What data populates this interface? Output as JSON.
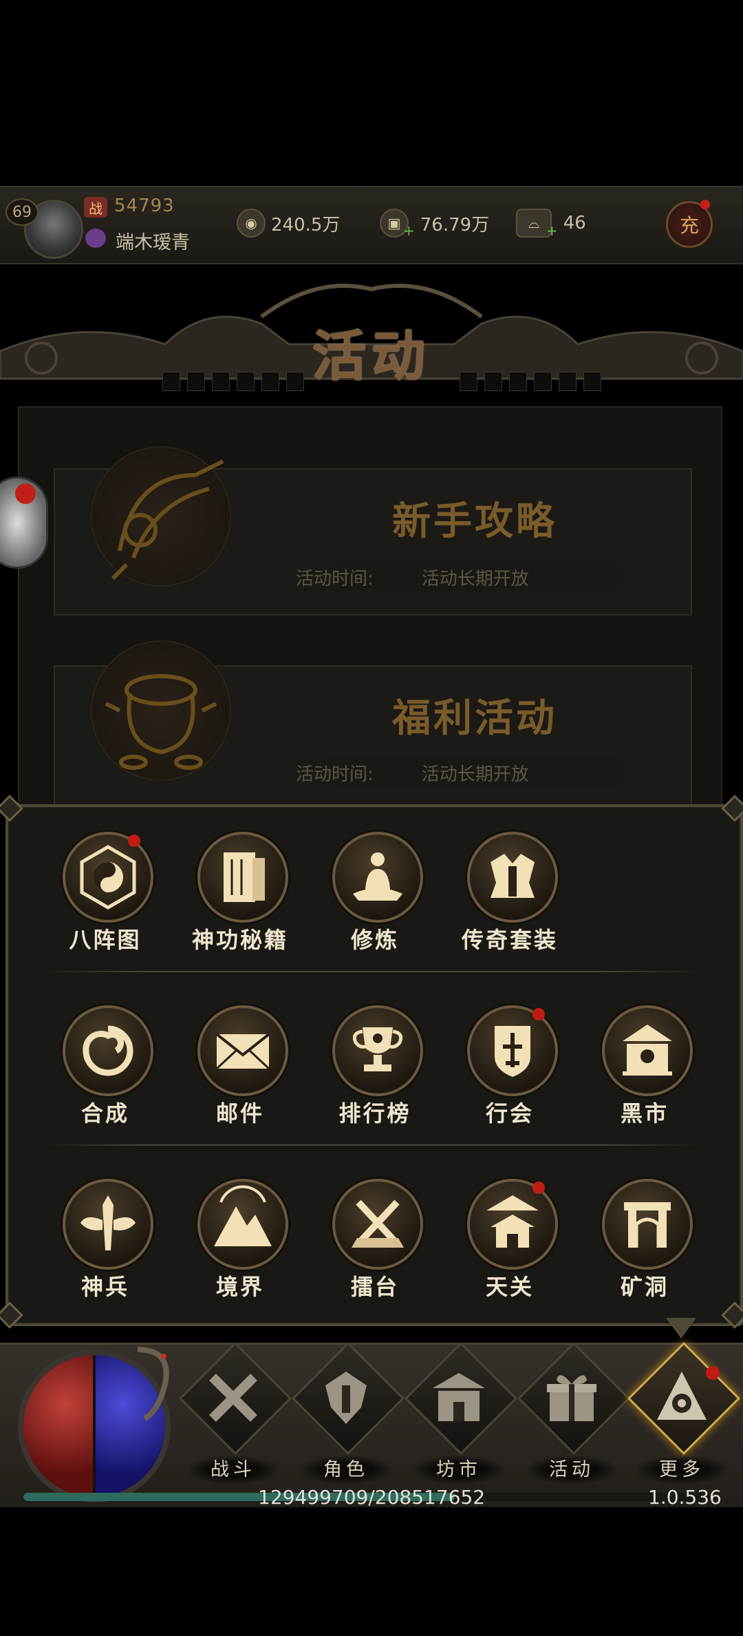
{
  "header": {
    "level": "69",
    "power_badge": "战",
    "power_value": "54793",
    "player_name": "端木瑷青",
    "resources": [
      {
        "icon": "copper-coin-icon",
        "value": "240.5万"
      },
      {
        "icon": "gold-ingot-icon",
        "value": "76.79万"
      },
      {
        "icon": "silver-ingot-icon",
        "value": "46"
      }
    ],
    "charge_label": "充"
  },
  "panel": {
    "title": "活动",
    "activities": [
      {
        "title": "新手攻略",
        "time_label": "活动时间:",
        "time_value": "活动长期开放"
      },
      {
        "title": "福利活动",
        "time_label": "活动时间:",
        "time_value": "活动长期开放"
      }
    ]
  },
  "more_menu": {
    "rows": [
      [
        {
          "label": "八阵图",
          "icon": "bagua-icon",
          "badge": true
        },
        {
          "label": "神功秘籍",
          "icon": "book-icon",
          "badge": false
        },
        {
          "label": "修炼",
          "icon": "meditation-icon",
          "badge": false
        },
        {
          "label": "传奇套装",
          "icon": "armor-icon",
          "badge": false
        }
      ],
      [
        {
          "label": "合成",
          "icon": "swirl-icon",
          "badge": false
        },
        {
          "label": "邮件",
          "icon": "mail-icon",
          "badge": false
        },
        {
          "label": "排行榜",
          "icon": "trophy-icon",
          "badge": false
        },
        {
          "label": "行会",
          "icon": "guild-shield-icon",
          "badge": true
        },
        {
          "label": "黑市",
          "icon": "black-market-icon",
          "badge": false
        }
      ],
      [
        {
          "label": "神兵",
          "icon": "winged-sword-icon",
          "badge": false
        },
        {
          "label": "境界",
          "icon": "mountain-icon",
          "badge": false
        },
        {
          "label": "擂台",
          "icon": "arena-icon",
          "badge": false
        },
        {
          "label": "天关",
          "icon": "pagoda-icon",
          "badge": true
        },
        {
          "label": "矿洞",
          "icon": "mine-gate-icon",
          "badge": false
        }
      ]
    ]
  },
  "bottom_nav": {
    "items": [
      {
        "label": "战斗",
        "icon": "crossed-swords-icon",
        "active": false
      },
      {
        "label": "角色",
        "icon": "helmet-icon",
        "active": false
      },
      {
        "label": "坊市",
        "icon": "market-hall-icon",
        "active": false
      },
      {
        "label": "活动",
        "icon": "gift-icon",
        "active": false
      },
      {
        "label": "更多",
        "icon": "more-emblem-icon",
        "active": true
      }
    ],
    "exp_text": "129499709/208517652",
    "exp_fraction": 0.621,
    "version": "1.0.536"
  }
}
